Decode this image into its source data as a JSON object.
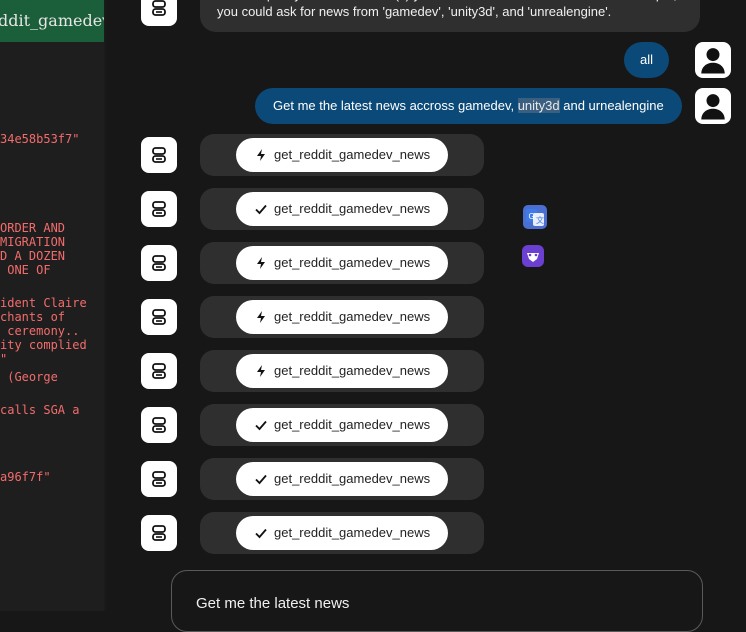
{
  "terminal": {
    "tab_title": "ddit_gamedev_",
    "lines": [
      "34e58b53f7\"",
      "ORDER AND",
      "MIGRATION",
      "D A DOZEN",
      " ONE OF",
      "ident Claire",
      "chants of",
      " ceremony..",
      "ity complied",
      "\"",
      " (George",
      "calls SGA a",
      "a96f7f\""
    ]
  },
  "chat": {
    "bot_intro": "Please specify which subreddit(s) you'd like me to check for news. For example, you could ask for news from 'gamedev', 'unity3d', and 'unrealengine'.",
    "user_messages": [
      {
        "text": "all"
      },
      {
        "pre": "Get me the latest news accross gamedev, ",
        "highlight": "unity3d",
        "post": " and urnealengine"
      }
    ],
    "tool_calls": [
      {
        "label": "get_reddit_gamedev_news",
        "status": "bolt-icon"
      },
      {
        "label": "get_reddit_gamedev_news",
        "status": "check-icon"
      },
      {
        "label": "get_reddit_gamedev_news",
        "status": "bolt-icon"
      },
      {
        "label": "get_reddit_gamedev_news",
        "status": "bolt-icon"
      },
      {
        "label": "get_reddit_gamedev_news",
        "status": "bolt-icon"
      },
      {
        "label": "get_reddit_gamedev_news",
        "status": "check-icon"
      },
      {
        "label": "get_reddit_gamedev_news",
        "status": "check-icon"
      },
      {
        "label": "get_reddit_gamedev_news",
        "status": "check-icon"
      }
    ],
    "input": {
      "value": "Get me the latest news"
    }
  },
  "colors": {
    "accent": "#0b4a78",
    "terminal_tab": "#1b5e3a",
    "terminal_text": "#f36c6c"
  }
}
